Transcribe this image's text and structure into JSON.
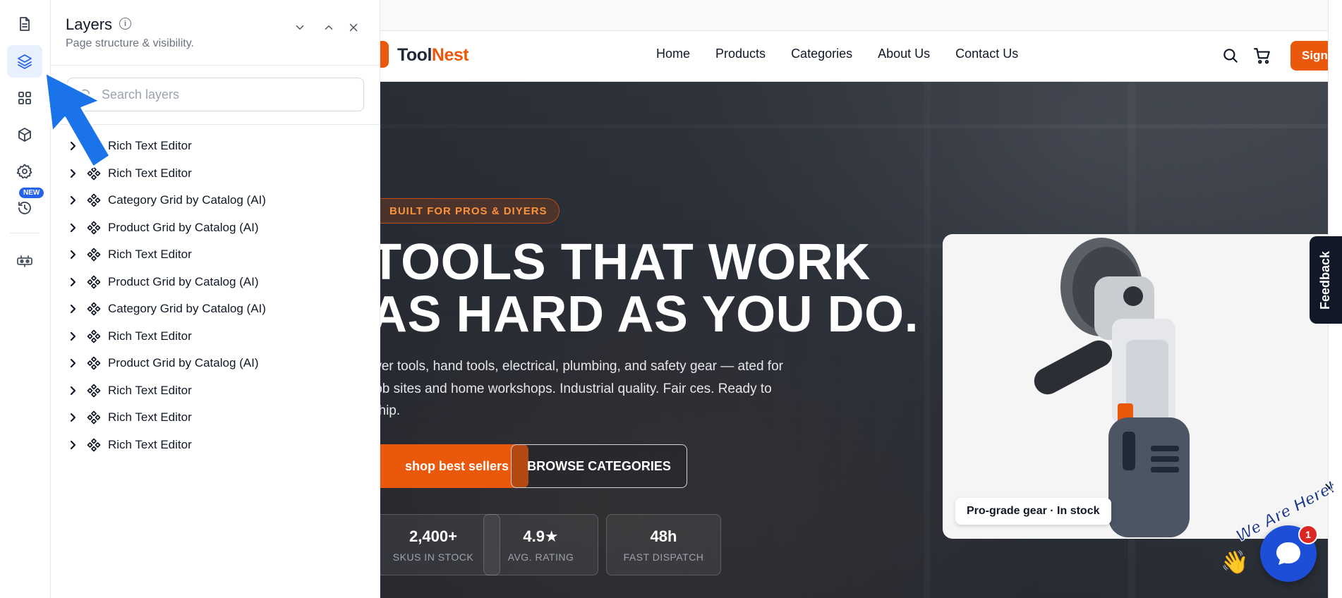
{
  "rail": {
    "items": [
      {
        "icon": "page-icon"
      },
      {
        "icon": "layers-icon",
        "active": true
      },
      {
        "icon": "grid-icon"
      },
      {
        "icon": "box-icon"
      },
      {
        "icon": "gear-icon"
      },
      {
        "icon": "history-icon"
      },
      {
        "icon": "robot-icon"
      }
    ],
    "new_badge": "NEW"
  },
  "layers_panel": {
    "title": "Layers",
    "subtitle": "Page structure & visibility.",
    "search_placeholder": "Search layers",
    "search_value": "",
    "items": [
      {
        "label": "Rich Text Editor"
      },
      {
        "label": "Rich Text Editor"
      },
      {
        "label": "Category Grid by Catalog (AI)"
      },
      {
        "label": "Product Grid by Catalog (AI)"
      },
      {
        "label": "Rich Text Editor"
      },
      {
        "label": "Product Grid by Catalog (AI)"
      },
      {
        "label": "Category Grid by Catalog (AI)"
      },
      {
        "label": "Rich Text Editor"
      },
      {
        "label": "Product Grid by Catalog (AI)"
      },
      {
        "label": "Rich Text Editor"
      },
      {
        "label": "Rich Text Editor"
      },
      {
        "label": "Rich Text Editor"
      }
    ]
  },
  "site": {
    "logo_part1": "Tool",
    "logo_part2": "Nest",
    "nav": [
      "Home",
      "Products",
      "Categories",
      "About Us",
      "Contact Us"
    ],
    "sign_label": "Sign",
    "hero": {
      "badge": "BUILT FOR PROS & DIYERS",
      "headline_line1": "TOOLS THAT WORK",
      "headline_line2": "AS HARD AS YOU DO.",
      "description": "wer tools, hand tools, electrical, plumbing, and safety gear — ated for job sites and home workshops. Industrial quality. Fair ces. Ready to ship.",
      "primary_cta": "shop best sellers",
      "secondary_cta": "BROWSE CATEGORIES",
      "stats": [
        {
          "value": "2,400+",
          "label": "SKUS IN STOCK"
        },
        {
          "value": "4.9★",
          "label": "AVG. RATING"
        },
        {
          "value": "48h",
          "label": "FAST DISPATCH"
        }
      ],
      "product_tag": "Pro-grade gear · In stock"
    }
  },
  "widgets": {
    "feedback_label": "Feedback",
    "chat_banner": "We Are Here!",
    "chat_unread": "1",
    "close_symbol": "✕"
  },
  "colors": {
    "accent": "#ea580c",
    "editor_active": "#2563eb",
    "chat_blue": "#1d4ed8"
  }
}
